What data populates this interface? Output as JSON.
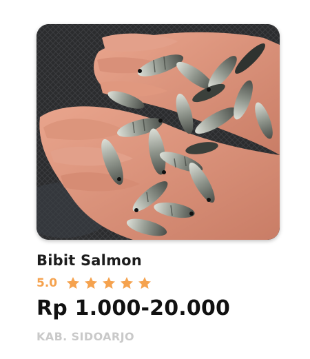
{
  "product": {
    "image_alt_icon": "fish-photo",
    "title": "Bibit Salmon",
    "rating": "5.0",
    "stars_filled": 5,
    "stars_total": 5,
    "price": "Rp 1.000-20.000",
    "location": "KAB. SIDOARJO"
  },
  "colors": {
    "star": "#f5a24e",
    "rating_text": "#f5a24e",
    "title": "#1d1d1d",
    "price": "#111111",
    "location": "#c9c9c9"
  }
}
